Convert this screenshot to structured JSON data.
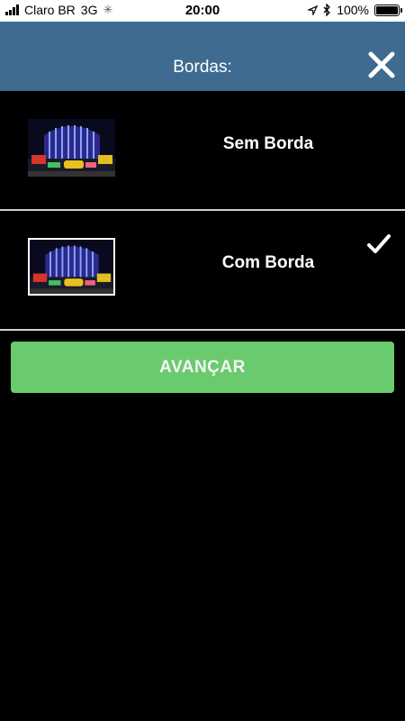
{
  "status_bar": {
    "carrier": "Claro BR",
    "network": "3G",
    "time": "20:00",
    "battery": "100%",
    "battery_level": 1.0
  },
  "header": {
    "title": "Bordas:",
    "close_icon": "close-icon"
  },
  "options": [
    {
      "label": "Sem Borda",
      "selected": false
    },
    {
      "label": "Com Borda",
      "selected": true
    }
  ],
  "actions": {
    "advance_label": "AVANÇAR"
  },
  "colors": {
    "header_bg": "#3e6b8f",
    "button_bg": "#6acb6e",
    "background": "#000000"
  }
}
